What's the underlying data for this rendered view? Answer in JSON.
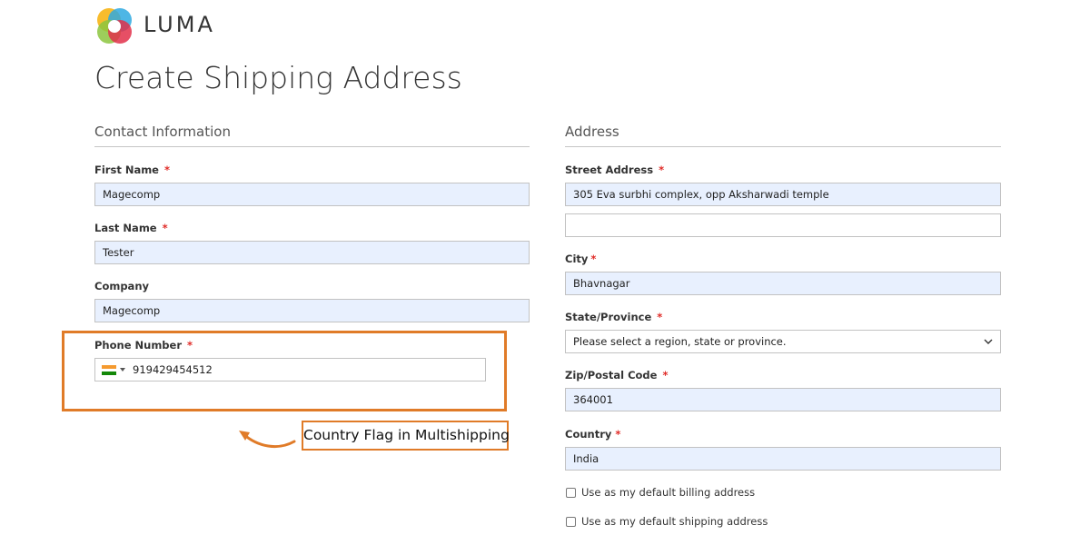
{
  "brand": {
    "logo_text": "LUMA",
    "colors": [
      "#f7b516",
      "#2fa9e0",
      "#e2304a",
      "#8cc63e"
    ]
  },
  "page": {
    "title": "Create Shipping Address"
  },
  "contact": {
    "section_title": "Contact Information",
    "first_name": {
      "label": "First Name",
      "required_mark": "*",
      "value": "Magecomp"
    },
    "last_name": {
      "label": "Last Name",
      "required_mark": "*",
      "value": "Tester"
    },
    "company": {
      "label": "Company",
      "value": "Magecomp"
    },
    "phone": {
      "label": "Phone Number",
      "required_mark": "*",
      "value": "919429454512",
      "flag_icon": "india-flag-icon"
    }
  },
  "address": {
    "section_title": "Address",
    "street": {
      "label": "Street Address",
      "required_mark": "*",
      "line1": "305 Eva surbhi complex, opp Aksharwadi temple",
      "line2": ""
    },
    "city": {
      "label": "City",
      "required_mark": "*",
      "value": "Bhavnagar"
    },
    "state": {
      "label": "State/Province",
      "required_mark": "*",
      "value": "Please select a region, state or province."
    },
    "zip": {
      "label": "Zip/Postal Code",
      "required_mark": "*",
      "value": "364001"
    },
    "country": {
      "label": "Country",
      "required_mark": "*",
      "value": "India"
    },
    "default_billing": {
      "label": "Use as my default billing address",
      "checked": false
    },
    "default_shipping": {
      "label": "Use as my default shipping address",
      "checked": false
    }
  },
  "annotation": {
    "callout_text": "Country Flag in Multishipping",
    "accent": "#e07b28"
  }
}
